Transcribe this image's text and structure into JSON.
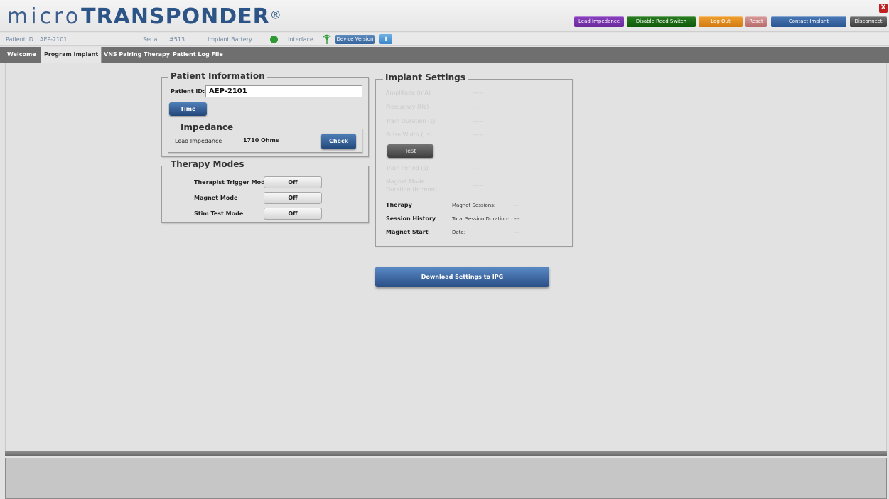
{
  "header": {
    "logo_micro": "micro",
    "logo_transponder": "TRANSPONDER",
    "logo_reg": "®",
    "buttons": {
      "lead_impedance": "Lead Impedance",
      "disable_reed": "Disable Reed Switch",
      "log_out": "Log Out",
      "reset": "Reset",
      "contact_implant": "Contact Implant",
      "disconnect": "Disconnect"
    },
    "close": "X"
  },
  "infobar": {
    "patient_id_label": "Patient ID",
    "patient_id_value": "AEP-2101",
    "serial_label": "Serial",
    "serial_value": "#513",
    "battery_label": "Implant Battery",
    "battery_color": "#2f9a34",
    "interface_label": "Interface",
    "interface_icon": "antenna-icon",
    "device_version": "Device Version",
    "info_icon": "i"
  },
  "tabs": [
    {
      "label": "Welcome",
      "active": false
    },
    {
      "label": "Program Implant",
      "active": true
    },
    {
      "label": "VNS Pairing Therapy",
      "active": false
    },
    {
      "label": "Patient Log File",
      "active": false
    }
  ],
  "patient_info": {
    "legend": "Patient Information",
    "pid_label": "Patient ID:",
    "pid_value": "AEP-2101",
    "time_button": "Time",
    "impedance": {
      "legend": "Impedance",
      "label": "Lead Impedance",
      "value": "1710 Ohms",
      "check_button": "Check"
    }
  },
  "therapy_modes": {
    "legend": "Therapy Modes",
    "modes": [
      {
        "label": "Therapist Trigger Mode",
        "state": "Off"
      },
      {
        "label": "Magnet Mode",
        "state": "Off"
      },
      {
        "label": "Stim Test Mode",
        "state": "Off"
      }
    ]
  },
  "implant_settings": {
    "legend": "Implant Settings",
    "params": [
      {
        "label": "Amplitude (mA)",
        "value": "-----"
      },
      {
        "label": "Frequency (Hz)",
        "value": "-----"
      },
      {
        "label": "Train Duration (s)",
        "value": "-----"
      },
      {
        "label": "Pulse Width (us)",
        "value": "-----"
      }
    ],
    "test_button": "Test",
    "params2": [
      {
        "label": "Train Period (s)",
        "value": "-----"
      },
      {
        "label_line1": "Magnet Mode",
        "label_line2": "Duration (hh:mm)",
        "value": "-----"
      }
    ],
    "status": [
      {
        "label": "Therapy",
        "key": "Magnet Sessions:",
        "value": "---"
      },
      {
        "label": "Session History",
        "key": "Total Session Duration:",
        "value": "---"
      },
      {
        "label": "Magnet Start",
        "key": "Date:",
        "value": "---"
      }
    ]
  },
  "download_button": "Download Settings to IPG"
}
